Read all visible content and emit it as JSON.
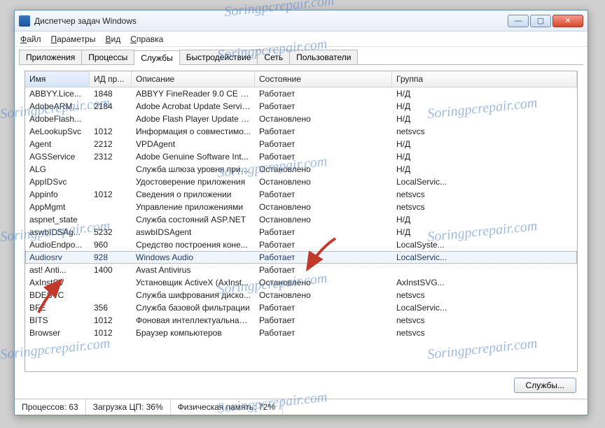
{
  "window": {
    "title": "Диспетчер задач Windows"
  },
  "menubar": {
    "file": "Файл",
    "options": "Параметры",
    "view": "Вид",
    "help": "Справка"
  },
  "tabs": {
    "applications": "Приложения",
    "processes": "Процессы",
    "services": "Службы",
    "performance": "Быстродействие",
    "network": "Сеть",
    "users": "Пользователи"
  },
  "columns": {
    "name": "Имя",
    "pid": "ИД пр...",
    "description": "Описание",
    "status": "Состояние",
    "group": "Группа"
  },
  "rows": [
    {
      "name": "ABBYY.Lice...",
      "pid": "1848",
      "desc": "ABBYY FineReader 9.0 CE Lic...",
      "status": "Работает",
      "group": "Н/Д"
    },
    {
      "name": "AdobeARM...",
      "pid": "2184",
      "desc": "Adobe Acrobat Update Service",
      "status": "Работает",
      "group": "Н/Д"
    },
    {
      "name": "AdobeFlash...",
      "pid": "",
      "desc": "Adobe Flash Player Update S...",
      "status": "Остановлено",
      "group": "Н/Д"
    },
    {
      "name": "AeLookupSvc",
      "pid": "1012",
      "desc": "Информация о совместимо...",
      "status": "Работает",
      "group": "netsvcs"
    },
    {
      "name": "Agent",
      "pid": "2212",
      "desc": "VPDAgent",
      "status": "Работает",
      "group": "Н/Д"
    },
    {
      "name": "AGSService",
      "pid": "2312",
      "desc": "Adobe Genuine Software Int...",
      "status": "Работает",
      "group": "Н/Д"
    },
    {
      "name": "ALG",
      "pid": "",
      "desc": "Служба шлюза уровня прил...",
      "status": "Остановлено",
      "group": "Н/Д"
    },
    {
      "name": "AppIDSvc",
      "pid": "",
      "desc": "Удостоверение приложения",
      "status": "Остановлено",
      "group": "LocalServic..."
    },
    {
      "name": "Appinfo",
      "pid": "1012",
      "desc": "Сведения о приложении",
      "status": "Работает",
      "group": "netsvcs"
    },
    {
      "name": "AppMgmt",
      "pid": "",
      "desc": "Управление приложениями",
      "status": "Остановлено",
      "group": "netsvcs"
    },
    {
      "name": "aspnet_state",
      "pid": "",
      "desc": "Служба состояний ASP.NET",
      "status": "Остановлено",
      "group": "Н/Д"
    },
    {
      "name": "aswbIDSAg...",
      "pid": "5232",
      "desc": "aswbIDSAgent",
      "status": "Работает",
      "group": "Н/Д"
    },
    {
      "name": "AudioEndpo...",
      "pid": "960",
      "desc": "Средство построения коне...",
      "status": "Работает",
      "group": "LocalSyste..."
    },
    {
      "name": "Audiosrv",
      "pid": "928",
      "desc": "Windows Audio",
      "status": "Работает",
      "group": "LocalServic...",
      "selected": true
    },
    {
      "name": "ast! Anti...",
      "pid": "1400",
      "desc": "Avast Antivirus",
      "status": "Работает",
      "group": ""
    },
    {
      "name": "AxInstSV",
      "pid": "",
      "desc": "Установщик ActiveX (AxInst...",
      "status": "Остановлено",
      "group": "AxInstSVG..."
    },
    {
      "name": "BDESVC",
      "pid": "",
      "desc": "Служба шифрования диско...",
      "status": "Остановлено",
      "group": "netsvcs"
    },
    {
      "name": "BFE",
      "pid": "356",
      "desc": "Служба базовой фильтрации",
      "status": "Работает",
      "group": "LocalServic..."
    },
    {
      "name": "BITS",
      "pid": "1012",
      "desc": "Фоновая интеллектуальная...",
      "status": "Работает",
      "group": "netsvcs"
    },
    {
      "name": "Browser",
      "pid": "1012",
      "desc": "Браузер компьютеров",
      "status": "Работает",
      "group": "netsvcs"
    }
  ],
  "buttons": {
    "services": "Службы..."
  },
  "statusbar": {
    "procs": "Процессов: 63",
    "cpu": "Загрузка ЦП: 36%",
    "mem": "Физическая память: 72%"
  },
  "watermark": "Soringpcrepair.com"
}
